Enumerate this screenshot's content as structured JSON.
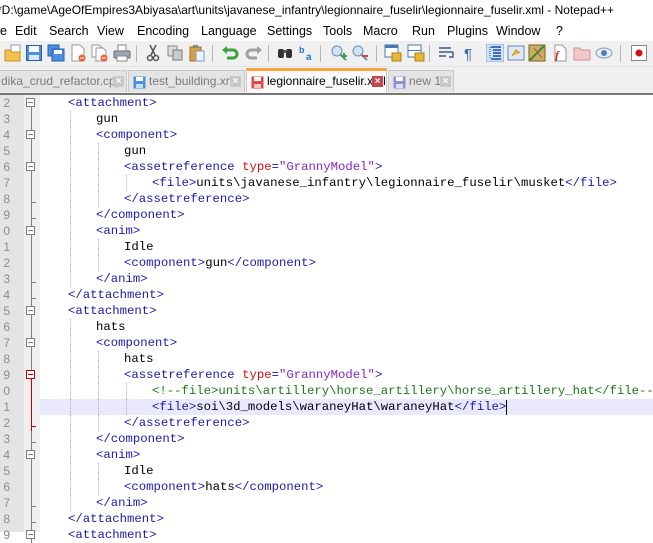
{
  "window": {
    "title": "*D:\\game\\AgeOfEmpires3Abiyasa\\art\\units\\javanese_infantry\\legionnaire_fuselir\\legionnaire_fuselir.xml - Notepad++"
  },
  "menu": {
    "items": [
      {
        "label": "e",
        "name": "file"
      },
      {
        "label": "Edit",
        "name": "edit"
      },
      {
        "label": "Search",
        "name": "search"
      },
      {
        "label": "View",
        "name": "view"
      },
      {
        "label": "Encoding",
        "name": "encoding"
      },
      {
        "label": "Language",
        "name": "language"
      },
      {
        "label": "Settings",
        "name": "settings"
      },
      {
        "label": "Tools",
        "name": "tools"
      },
      {
        "label": "Macro",
        "name": "macro"
      },
      {
        "label": "Run",
        "name": "run"
      },
      {
        "label": "Plugins",
        "name": "plugins"
      },
      {
        "label": "Window",
        "name": "window"
      },
      {
        "label": "?",
        "name": "help"
      }
    ]
  },
  "toolbar": {
    "buttons": [
      "open-file-icon",
      "save-icon",
      "save-all-icon",
      "close-icon",
      "close-all-icon",
      "print-icon",
      "cut-icon",
      "copy-icon",
      "paste-icon",
      "undo-icon",
      "redo-icon",
      "find-icon",
      "replace-icon",
      "zoom-in-icon",
      "zoom-out-icon",
      "sync-vertical-icon",
      "sync-horizontal-icon",
      "word-wrap-icon",
      "show-all-chars-icon",
      "indent-guide-icon",
      "udl-icon",
      "document-map-icon",
      "function-list-icon",
      "folder-workspace-icon",
      "monitoring-icon",
      "record-macro-icon"
    ]
  },
  "tabs": [
    {
      "label": "dika_crud_refactor.cpp",
      "active": false,
      "state": "saved"
    },
    {
      "label": "test_building.xml",
      "active": false,
      "state": "saved"
    },
    {
      "label": "legionnaire_fuselir.xml",
      "active": true,
      "state": "modified"
    },
    {
      "label": "new 1",
      "active": false,
      "state": "saved-gray"
    }
  ],
  "editor": {
    "current_line": "1",
    "lines": [
      {
        "num": "2",
        "indent": 1,
        "fold": "box",
        "parts": [
          {
            "t": "tag",
            "v": "<attachment>"
          }
        ]
      },
      {
        "num": "3",
        "indent": 2,
        "fold": "line",
        "parts": [
          {
            "t": "txt",
            "v": "gun"
          }
        ]
      },
      {
        "num": "4",
        "indent": 2,
        "fold": "box",
        "parts": [
          {
            "t": "tag",
            "v": "<component>"
          }
        ]
      },
      {
        "num": "5",
        "indent": 3,
        "fold": "line",
        "parts": [
          {
            "t": "txt",
            "v": "gun"
          }
        ]
      },
      {
        "num": "6",
        "indent": 3,
        "fold": "box",
        "parts": [
          {
            "t": "tag",
            "v": "<assetreference "
          },
          {
            "t": "attr",
            "v": "type"
          },
          {
            "t": "tag",
            "v": "="
          },
          {
            "t": "val",
            "v": "\"GrannyModel\""
          },
          {
            "t": "tag",
            "v": ">"
          }
        ]
      },
      {
        "num": "7",
        "indent": 4,
        "fold": "line",
        "parts": [
          {
            "t": "tag",
            "v": "<file>"
          },
          {
            "t": "txt",
            "v": "units\\javanese_infantry\\legionnaire_fuselir\\musket"
          },
          {
            "t": "tag",
            "v": "</file>"
          }
        ]
      },
      {
        "num": "8",
        "indent": 3,
        "fold": "end",
        "parts": [
          {
            "t": "tag",
            "v": "</assetreference>"
          }
        ]
      },
      {
        "num": "9",
        "indent": 2,
        "fold": "end",
        "parts": [
          {
            "t": "tag",
            "v": "</component>"
          }
        ]
      },
      {
        "num": "0",
        "indent": 2,
        "fold": "box",
        "parts": [
          {
            "t": "tag",
            "v": "<anim>"
          }
        ]
      },
      {
        "num": "1",
        "indent": 3,
        "fold": "line",
        "parts": [
          {
            "t": "txt",
            "v": "Idle"
          }
        ]
      },
      {
        "num": "2",
        "indent": 3,
        "fold": "line",
        "parts": [
          {
            "t": "tag",
            "v": "<component>"
          },
          {
            "t": "txt",
            "v": "gun"
          },
          {
            "t": "tag",
            "v": "</component>"
          }
        ]
      },
      {
        "num": "3",
        "indent": 2,
        "fold": "end",
        "parts": [
          {
            "t": "tag",
            "v": "</anim>"
          }
        ]
      },
      {
        "num": "4",
        "indent": 1,
        "fold": "end",
        "parts": [
          {
            "t": "tag",
            "v": "</attachment>"
          }
        ]
      },
      {
        "num": "5",
        "indent": 1,
        "fold": "box",
        "parts": [
          {
            "t": "tag",
            "v": "<attachment>"
          }
        ]
      },
      {
        "num": "6",
        "indent": 2,
        "fold": "line",
        "parts": [
          {
            "t": "txt",
            "v": "hats"
          }
        ]
      },
      {
        "num": "7",
        "indent": 2,
        "fold": "box",
        "parts": [
          {
            "t": "tag",
            "v": "<component>"
          }
        ]
      },
      {
        "num": "8",
        "indent": 3,
        "fold": "line",
        "parts": [
          {
            "t": "txt",
            "v": "hats"
          }
        ]
      },
      {
        "num": "9",
        "indent": 3,
        "fold": "redbox",
        "parts": [
          {
            "t": "tag",
            "v": "<assetreference "
          },
          {
            "t": "attr",
            "v": "type"
          },
          {
            "t": "tag",
            "v": "="
          },
          {
            "t": "val",
            "v": "\"GrannyModel\""
          },
          {
            "t": "tag",
            "v": ">"
          }
        ]
      },
      {
        "num": "0",
        "indent": 4,
        "fold": "redline",
        "parts": [
          {
            "t": "cmt",
            "v": "<!--file>units\\artillery\\horse_artillery\\horse_artillery_hat</file-->"
          }
        ]
      },
      {
        "num": "1",
        "indent": 4,
        "fold": "redline",
        "current": true,
        "parts": [
          {
            "t": "tag",
            "v": "<file>"
          },
          {
            "t": "txt",
            "v": "soi\\3d_models\\waraneyHat\\waraneyHat"
          },
          {
            "t": "tag",
            "v": "</file>"
          }
        ]
      },
      {
        "num": "2",
        "indent": 3,
        "fold": "redend",
        "parts": [
          {
            "t": "tag",
            "v": "</assetreference>"
          }
        ]
      },
      {
        "num": "3",
        "indent": 2,
        "fold": "end",
        "parts": [
          {
            "t": "tag",
            "v": "</component>"
          }
        ]
      },
      {
        "num": "4",
        "indent": 2,
        "fold": "box",
        "parts": [
          {
            "t": "tag",
            "v": "<anim>"
          }
        ]
      },
      {
        "num": "5",
        "indent": 3,
        "fold": "line",
        "parts": [
          {
            "t": "txt",
            "v": "Idle"
          }
        ]
      },
      {
        "num": "6",
        "indent": 3,
        "fold": "line",
        "parts": [
          {
            "t": "tag",
            "v": "<component>"
          },
          {
            "t": "txt",
            "v": "hats"
          },
          {
            "t": "tag",
            "v": "</component>"
          }
        ]
      },
      {
        "num": "7",
        "indent": 2,
        "fold": "end",
        "parts": [
          {
            "t": "tag",
            "v": "</anim>"
          }
        ]
      },
      {
        "num": "8",
        "indent": 1,
        "fold": "end",
        "parts": [
          {
            "t": "tag",
            "v": "</attachment>"
          }
        ]
      },
      {
        "num": "9",
        "indent": 1,
        "fold": "box",
        "parts": [
          {
            "t": "tag",
            "v": "<attachment>"
          }
        ]
      }
    ]
  },
  "colors": {
    "tag": "#1a1ab0",
    "attr": "#d01010",
    "value": "#8a24c8",
    "comment": "#1a7a1a",
    "current_line": "#e8e8ff",
    "active_tab_accent": "#f9a33a",
    "fold_highlight": "#c00000"
  }
}
